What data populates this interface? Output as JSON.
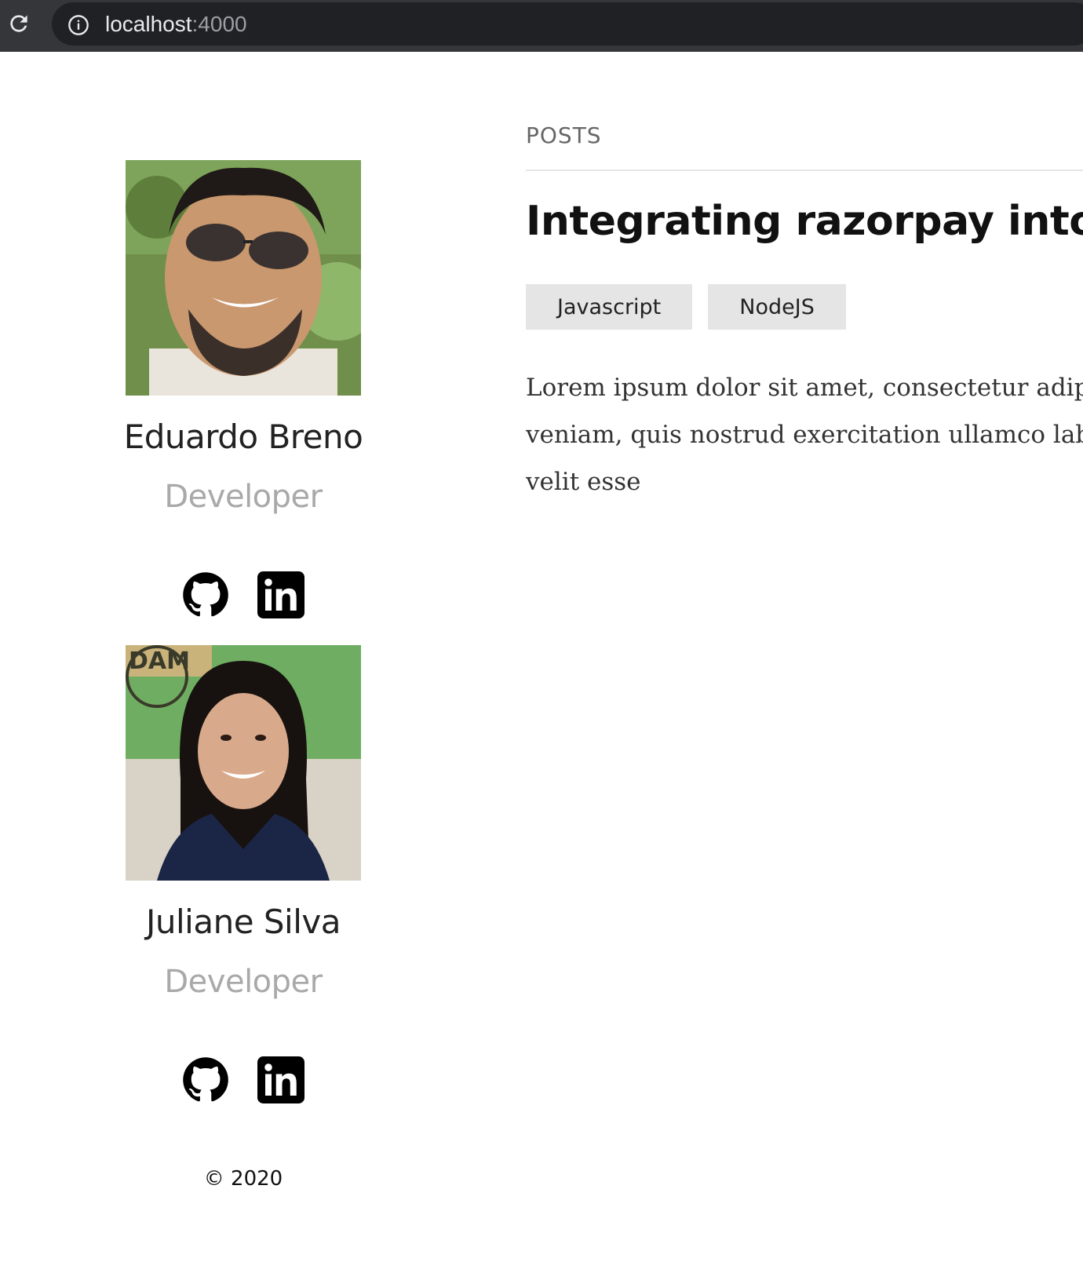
{
  "browser": {
    "url_host": "localhost",
    "url_port": ":4000"
  },
  "sidebar": {
    "authors": [
      {
        "name": "Eduardo Breno",
        "role": "Developer",
        "social": [
          "github-icon",
          "linkedin-icon"
        ]
      },
      {
        "name": "Juliane Silva",
        "role": "Developer",
        "social": [
          "github-icon",
          "linkedin-icon"
        ]
      }
    ],
    "copyright": "© 2020"
  },
  "main": {
    "section_title": "POSTS",
    "posts": [
      {
        "title": "Integrating razorpay into yo",
        "tags": [
          "Javascript",
          "NodeJS"
        ],
        "excerpt_lines": [
          "Lorem ipsum dolor sit amet, consectetur adip",
          "veniam, quis nostrud exercitation ullamco lab",
          "velit esse"
        ]
      }
    ]
  },
  "colors": {
    "chrome_bg": "#35363a",
    "address_bg": "#202124",
    "tag_bg": "#e5e5e5",
    "role_text": "#a9a9a9"
  }
}
